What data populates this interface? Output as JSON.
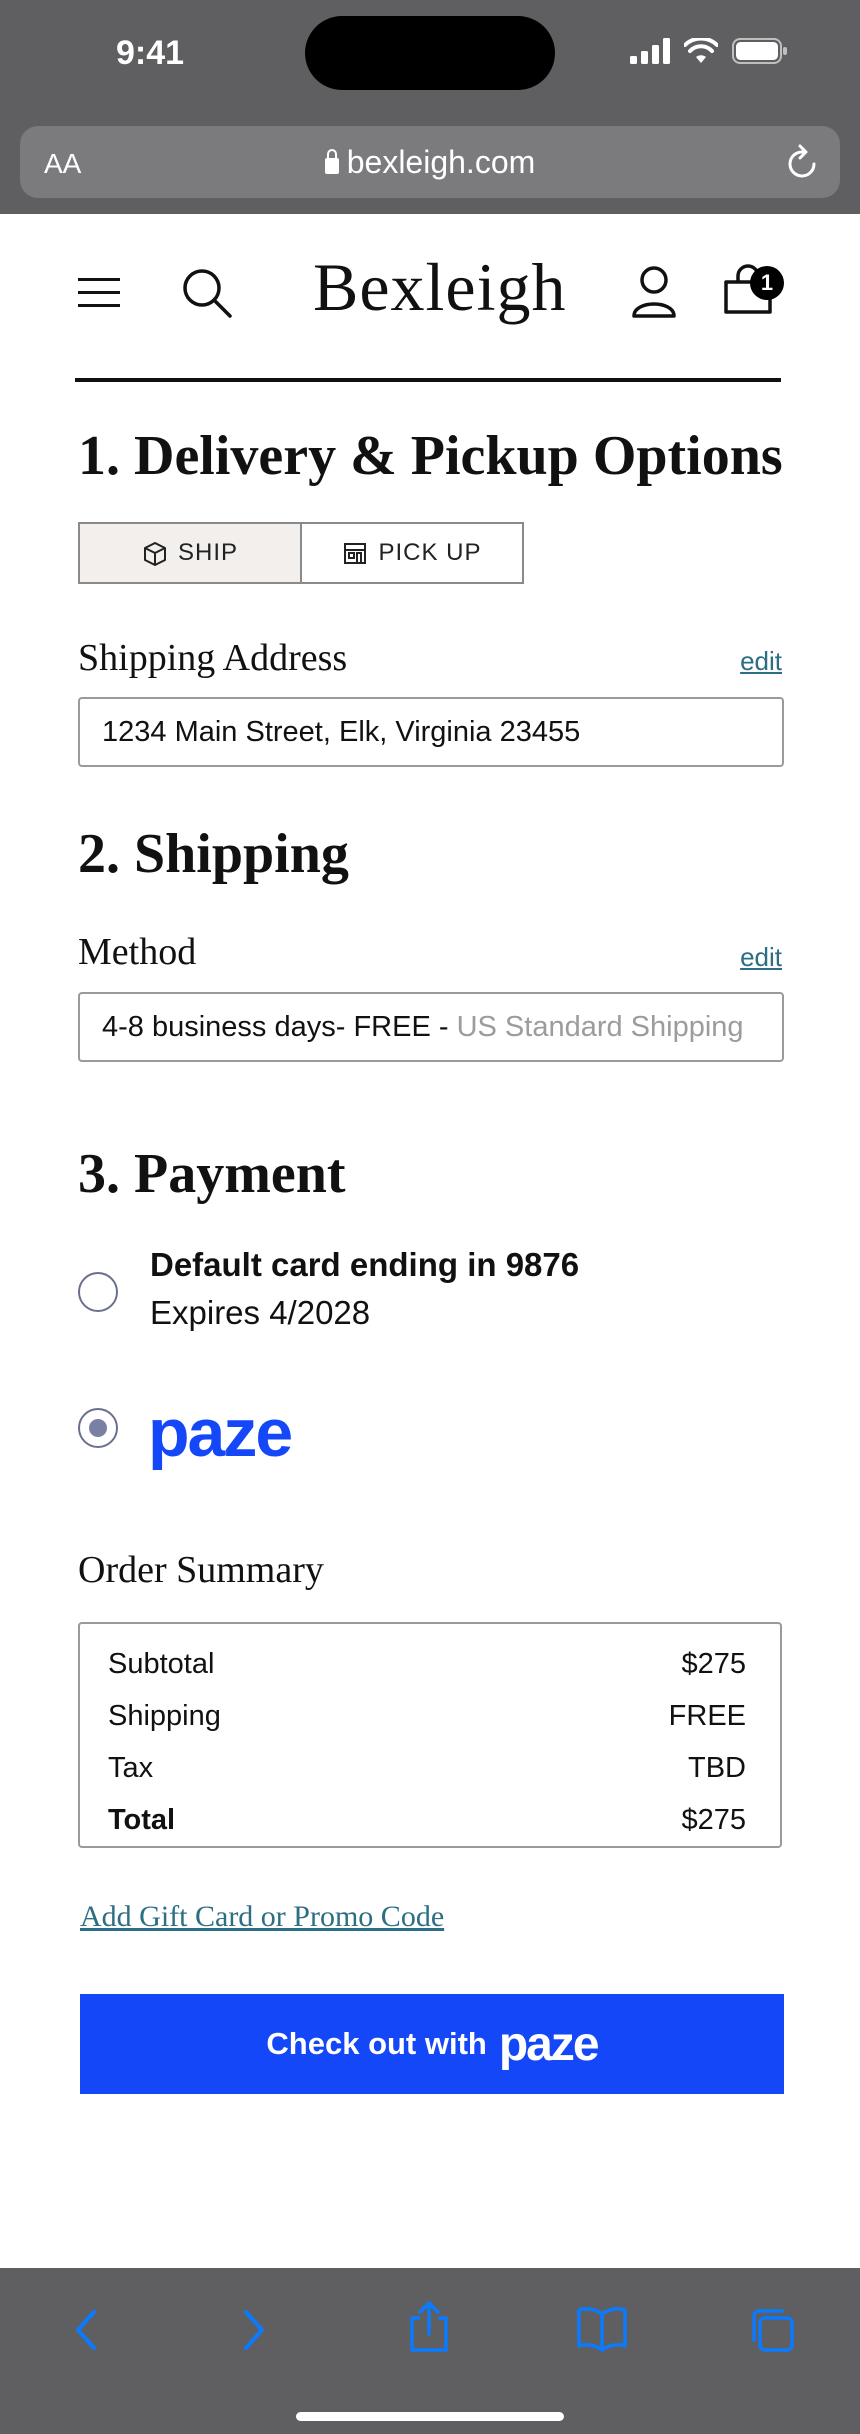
{
  "status_bar": {
    "time": "9:41"
  },
  "browser": {
    "text_size_label": "AA",
    "url": "bexleigh.com"
  },
  "site": {
    "logo": "Bexleigh",
    "cart_count": "1"
  },
  "delivery": {
    "heading": "1. Delivery & Pickup Options",
    "options": [
      {
        "label": "SHIP",
        "selected": true
      },
      {
        "label": "PICK UP",
        "selected": false
      }
    ],
    "address_label": "Shipping Address",
    "edit_label": "edit",
    "address_value": "1234 Main Street, Elk, Virginia 23455"
  },
  "shipping": {
    "heading": "2. Shipping",
    "method_label": "Method",
    "edit_label": "edit",
    "method_value": "4-8 business days- FREE - ",
    "method_name": "US Standard Shipping"
  },
  "payment": {
    "heading": "3. Payment",
    "card_title": "Default card ending in 9876",
    "card_expiry": "Expires 4/2028",
    "paze_label": "paze",
    "selected": "paze"
  },
  "order_summary": {
    "heading": "Order Summary",
    "rows": [
      {
        "label": "Subtotal",
        "value": "$275"
      },
      {
        "label": "Shipping",
        "value": "FREE"
      },
      {
        "label": "Tax",
        "value": "TBD"
      },
      {
        "label": "Total",
        "value": "$275"
      }
    ]
  },
  "promo_link": "Add Gift Card or Promo Code",
  "checkout": {
    "label": "Check out with",
    "brand": "paze"
  },
  "colors": {
    "accent": "#1447f7",
    "link": "#2c6e83",
    "chrome": "#5f5f61",
    "ios_blue": "#0a7aff"
  },
  "icons": [
    "signal-icon",
    "wifi-icon",
    "battery-icon",
    "lock-icon",
    "reload-icon",
    "hamburger-icon",
    "search-icon",
    "account-icon",
    "cart-icon",
    "box-icon",
    "store-icon",
    "back-icon",
    "forward-icon",
    "share-icon",
    "bookmarks-icon",
    "tabs-icon"
  ]
}
